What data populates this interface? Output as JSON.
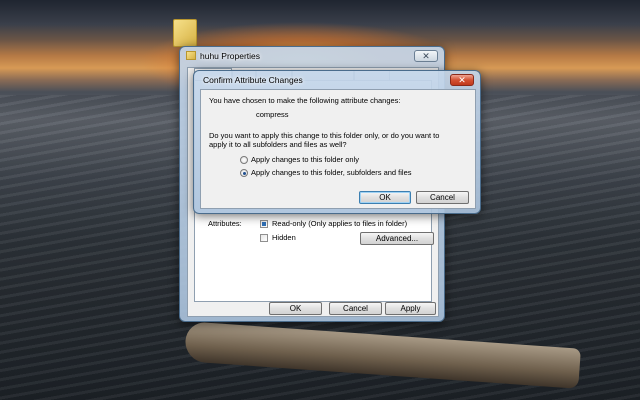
{
  "desktop": {
    "folder_icon": "folder-icon"
  },
  "properties_window": {
    "title": "huhu Properties",
    "close_symbol": "✕",
    "attributes_label": "Attributes:",
    "read_only_label": "Read-only (Only applies to files in folder)",
    "hidden_label": "Hidden",
    "advanced_button": "Advanced...",
    "ok_button": "OK",
    "cancel_button": "Cancel",
    "apply_button": "Apply"
  },
  "confirm_dialog": {
    "title": "Confirm Attribute Changes",
    "close_symbol": "✕",
    "intro": "You have chosen to make the following attribute changes:",
    "change": "compress",
    "question_line1": "Do you want to apply this change to this folder only, or do you want to",
    "question_line2": "apply it to all subfolders and files as well?",
    "options": [
      {
        "label": "Apply changes to this folder only",
        "selected": false
      },
      {
        "label": "Apply changes to this folder, subfolders and files",
        "selected": true
      }
    ],
    "ok_button": "OK",
    "cancel_button": "Cancel"
  }
}
